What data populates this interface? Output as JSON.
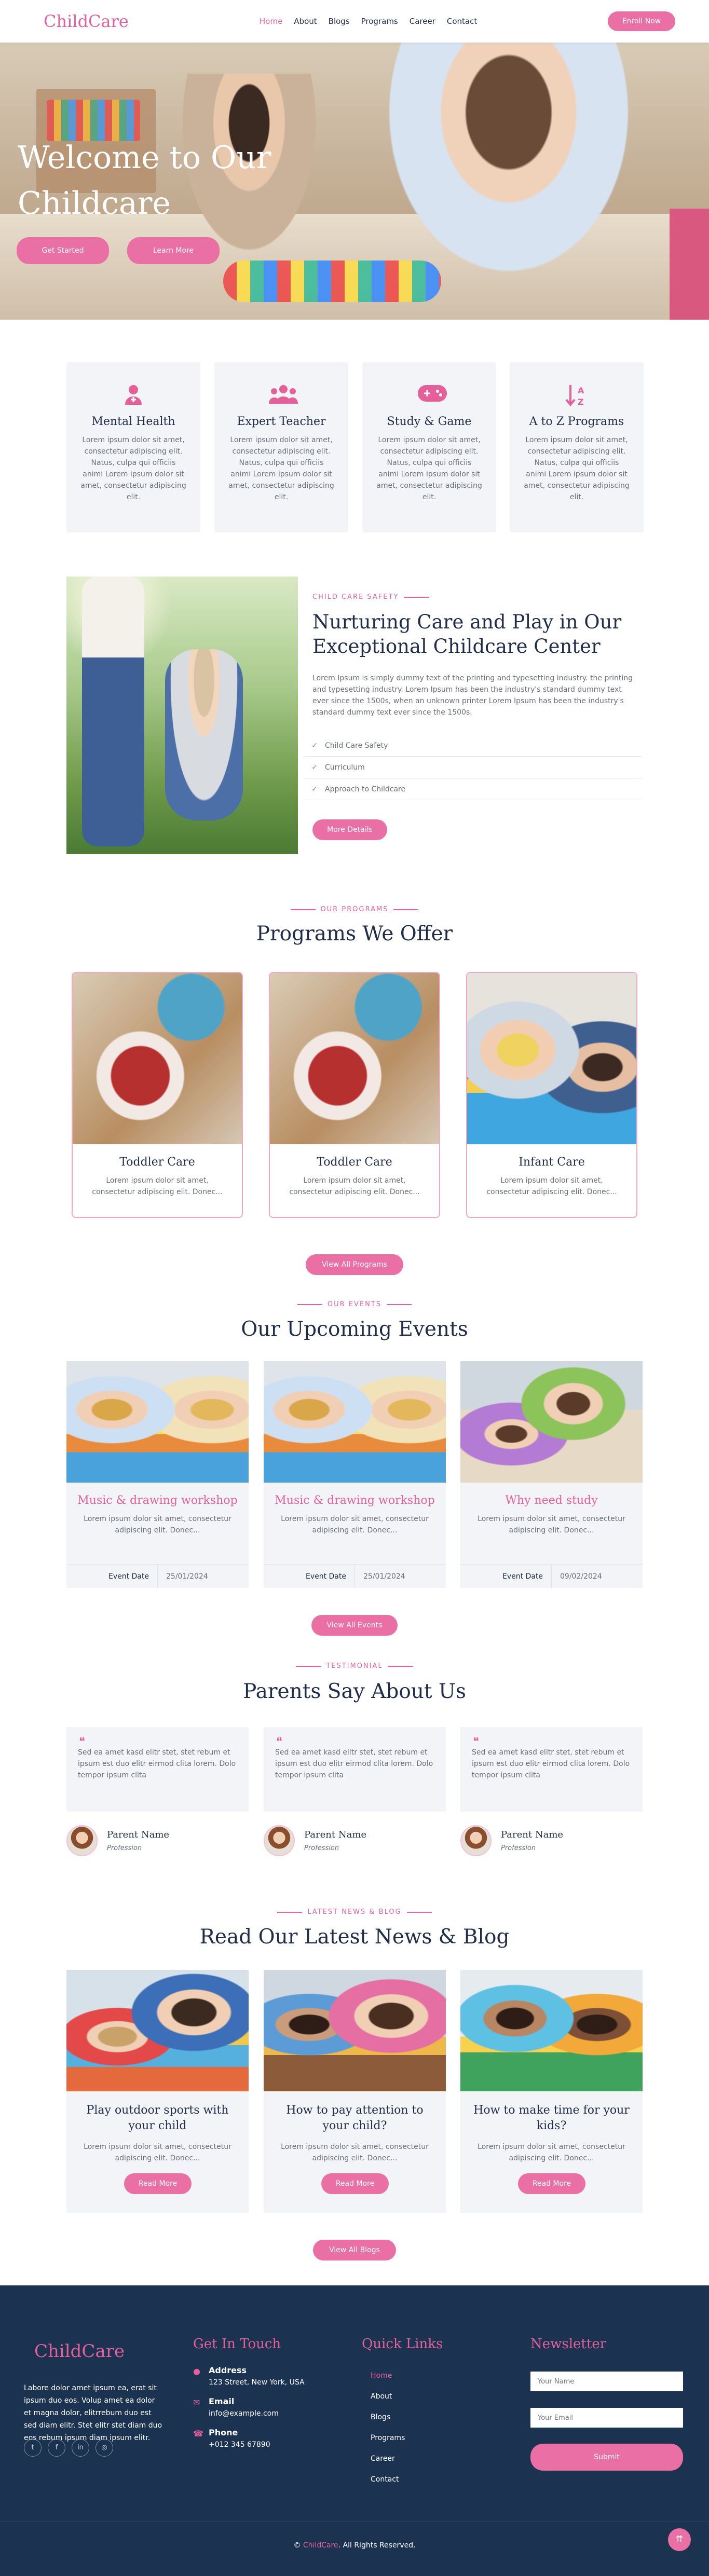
{
  "nav": {
    "logo": "ChildCare",
    "items": [
      "Home",
      "About",
      "Blogs",
      "Programs",
      "Career",
      "Contact"
    ],
    "active_item": "Home",
    "cta": "Enroll Now"
  },
  "hero": {
    "title_line1": "Welcome to Our",
    "title_line2": "Childcare",
    "btn_primary": "Get Started",
    "btn_secondary": "Learn More"
  },
  "features": [
    {
      "icon": "mental-health-icon",
      "title": "Mental Health",
      "text": "Lorem ipsum dolor sit amet, consectetur adipiscing elit. Natus, culpa qui officiis animi Lorem ipsum dolor sit amet, consectetur adipiscing elit."
    },
    {
      "icon": "teacher-group-icon",
      "title": "Expert Teacher",
      "text": "Lorem ipsum dolor sit amet, consectetur adipiscing elit. Natus, culpa qui officiis animi Lorem ipsum dolor sit amet, consectetur adipiscing elit."
    },
    {
      "icon": "gamepad-icon",
      "title": "Study & Game",
      "text": "Lorem ipsum dolor sit amet, consectetur adipiscing elit. Natus, culpa qui officiis animi Lorem ipsum dolor sit amet, consectetur adipiscing elit."
    },
    {
      "icon": "sort-az-icon",
      "title": "A to Z Programs",
      "text": "Lorem ipsum dolor sit amet, consectetur adipiscing elit. Natus, culpa qui officiis animi Lorem ipsum dolor sit amet, consectetur adipiscing elit."
    }
  ],
  "about": {
    "tag": "CHILD CARE SAFETY",
    "title": "Nurturing Care and Play in Our Exceptional Childcare Center",
    "text": "Lorem Ipsum is simply dummy text of the printing and typesetting industry. the printing and typesetting industry. Lorem Ipsum has been the industry's standard dummy text ever since the 1500s, when an unknown printer Lorem Ipsum has been the industry's standard dummy text ever since the 1500s.",
    "checks": [
      "Child Care Safety",
      "Curriculum",
      "Approach to Childcare"
    ],
    "button": "More Details"
  },
  "programs": {
    "tag": "OUR PROGRAMS",
    "title": "Programs We Offer",
    "items": [
      {
        "title": "Toddler Care",
        "text": "Lorem ipsum dolor sit amet, consectetur adipiscing elit. Donec..."
      },
      {
        "title": "Toddler Care",
        "text": "Lorem ipsum dolor sit amet, consectetur adipiscing elit. Donec..."
      },
      {
        "title": "Infant Care",
        "text": "Lorem ipsum dolor sit amet, consectetur adipiscing elit. Donec..."
      }
    ],
    "button": "View All Programs"
  },
  "events": {
    "tag": "OUR EVENTS",
    "title": "Our Upcoming Events",
    "date_label": "Event Date",
    "items": [
      {
        "title": "Music & drawing workshop",
        "text": "Lorem ipsum dolor sit amet, consectetur adipiscing elit. Donec...",
        "date": "25/01/2024"
      },
      {
        "title": "Music & drawing workshop",
        "text": "Lorem ipsum dolor sit amet, consectetur adipiscing elit. Donec...",
        "date": "25/01/2024"
      },
      {
        "title": "Why need study",
        "text": "Lorem ipsum dolor sit amet, consectetur adipiscing elit. Donec...",
        "date": "09/02/2024"
      }
    ],
    "button": "View All Events"
  },
  "testimonials": {
    "tag": "TESTIMONIAL",
    "title": "Parents Say About Us",
    "items": [
      {
        "quote": "Sed ea amet kasd elitr stet, stet rebum et ipsum est duo elitr eirmod clita lorem. Dolo tempor ipsum clita",
        "name": "Parent Name",
        "role": "Profession"
      },
      {
        "quote": "Sed ea amet kasd elitr stet, stet rebum et ipsum est duo elitr eirmod clita lorem. Dolo tempor ipsum clita",
        "name": "Parent Name",
        "role": "Profession"
      },
      {
        "quote": "Sed ea amet kasd elitr stet, stet rebum et ipsum est duo elitr eirmod clita lorem. Dolo tempor ipsum clita",
        "name": "Parent Name",
        "role": "Profession"
      }
    ]
  },
  "blog": {
    "tag": "LATEST NEWS & BLOG",
    "title": "Read Our Latest News & Blog",
    "items": [
      {
        "title": "Play outdoor sports with your child",
        "text": "Lorem ipsum dolor sit amet, consectetur adipiscing elit. Donec...",
        "button": "Read More"
      },
      {
        "title": "How to pay attention to your child?",
        "text": "Lorem ipsum dolor sit amet, consectetur adipiscing elit. Donec...",
        "button": "Read More"
      },
      {
        "title": "How to make time for your kids?",
        "text": "Lorem ipsum dolor sit amet, consectetur adipiscing elit. Donec...",
        "button": "Read More"
      }
    ],
    "button": "View All Blogs"
  },
  "footer": {
    "logo": "ChildCare",
    "about": "Labore dolor amet ipsum ea, erat sit ipsum duo eos. Volup amet ea dolor et magna dolor, elitrrebum duo est sed diam elitr. Stet elitr stet diam duo eos rebum ipsum diam ipsum elitr.",
    "socials": [
      "twitter-icon",
      "facebook-icon",
      "linkedin-icon",
      "instagram-icon"
    ],
    "contact_heading": "Get In Touch",
    "address_label": "Address",
    "address": "123 Street, New York, USA",
    "email_label": "Email",
    "email": "info@example.com",
    "phone_label": "Phone",
    "phone": "+012 345 67890",
    "links_heading": "Quick Links",
    "links": [
      "Home",
      "About",
      "Blogs",
      "Programs",
      "Career",
      "Contact"
    ],
    "newsletter_heading": "Newsletter",
    "name_placeholder": "Your Name",
    "email_placeholder": "Your Email",
    "submit": "Submit",
    "copyright_prefix": "©",
    "copyright_brand": "ChildCare",
    "copyright_suffix": ". All Rights Reserved."
  },
  "colors": {
    "accent": "#ea6fa4",
    "navy": "#1b3251",
    "heading": "#1f2c4a"
  }
}
